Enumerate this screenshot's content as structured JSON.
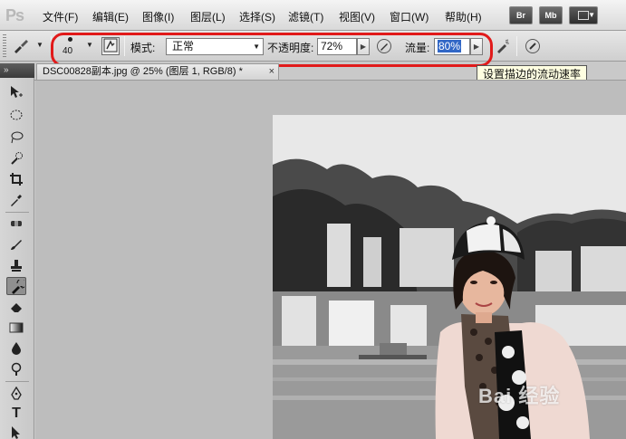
{
  "app": {
    "logo": "Ps"
  },
  "menu": {
    "items": [
      "文件(F)",
      "编辑(E)",
      "图像(I)",
      "图层(L)",
      "选择(S)",
      "滤镜(T)",
      "视图(V)",
      "窗口(W)",
      "帮助(H)"
    ],
    "app_buttons": {
      "bridge": "Br",
      "mini_bridge": "Mb"
    }
  },
  "options": {
    "brush_size": "40",
    "mode_label": "模式:",
    "mode_value": "正常",
    "opacity_label": "不透明度:",
    "opacity_value": "72%",
    "flow_label": "流量:",
    "flow_value": "80%",
    "tooltip": "设置描边的流动速率"
  },
  "document": {
    "tab_title": "DSC00828副本.jpg @ 25% (图层 1, RGB/8) *",
    "close": "×"
  },
  "watermark": "Bai 经验",
  "icons": {
    "tool_preset": "brush-preset-icon",
    "brush_panel": "brush-panel-icon",
    "pressure": "pressure-pen-icon",
    "airbrush": "airbrush-icon"
  },
  "colors": {
    "highlight": "#3167c6",
    "annotation": "#e11a1a",
    "tooltip_bg": "#ffffe1"
  }
}
